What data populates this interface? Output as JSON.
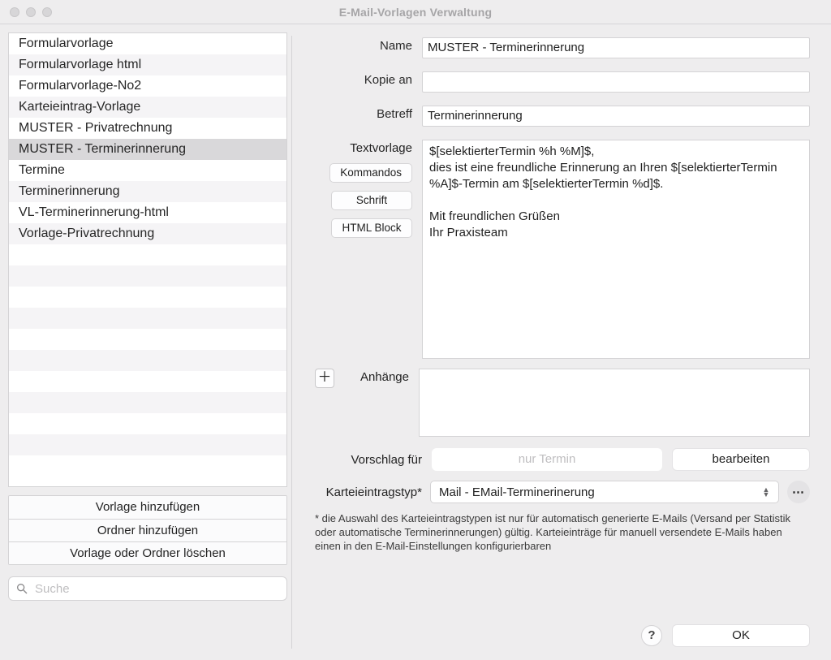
{
  "window": {
    "title": "E-Mail-Vorlagen Verwaltung"
  },
  "sidebar": {
    "items": [
      "Formularvorlage",
      "Formularvorlage html",
      "Formularvorlage-No2",
      "Karteieintrag-Vorlage",
      "MUSTER - Privatrechnung",
      "MUSTER - Terminerinnerung",
      "Termine",
      "Terminerinnerung",
      "VL-Terminerinnerung-html",
      "Vorlage-Privatrechnung"
    ],
    "selected_index": 5,
    "actions": {
      "add_template": "Vorlage hinzufügen",
      "add_folder": "Ordner hinzufügen",
      "delete": "Vorlage oder Ordner löschen"
    },
    "search_placeholder": "Suche"
  },
  "form": {
    "labels": {
      "name": "Name",
      "copy_to": "Kopie an",
      "subject": "Betreff",
      "template": "Textvorlage",
      "attachments": "Anhänge",
      "suggestion": "Vorschlag für",
      "record_type": "Karteieintragstyp*"
    },
    "buttons": {
      "commands": "Kommandos",
      "font": "Schrift",
      "html_block": "HTML Block",
      "edit": "bearbeiten",
      "ok": "OK",
      "help": "?"
    },
    "values": {
      "name": "MUSTER - Terminerinnerung",
      "copy_to": "",
      "subject": "Terminerinnerung",
      "template_body": "$[selektierterTermin %h %M]$,\ndies ist eine freundliche Erinnerung an Ihren $[selektierterTermin %A]$-Termin am $[selektierterTermin %d]$.\n\nMit freundlichen Grüßen\nIhr Praxisteam",
      "suggestion": "nur Termin",
      "record_type": "Mail - EMail-Terminerinerung"
    },
    "hint": "* die Auswahl des Karteieintragstypen ist nur für automatisch generierte E-Mails (Versand per Statistik oder automatische Terminerinnerungen) gültig. Karteieinträge für manuell versendete E-Mails haben einen in den E-Mail-Einstellungen konfigurierbaren"
  }
}
